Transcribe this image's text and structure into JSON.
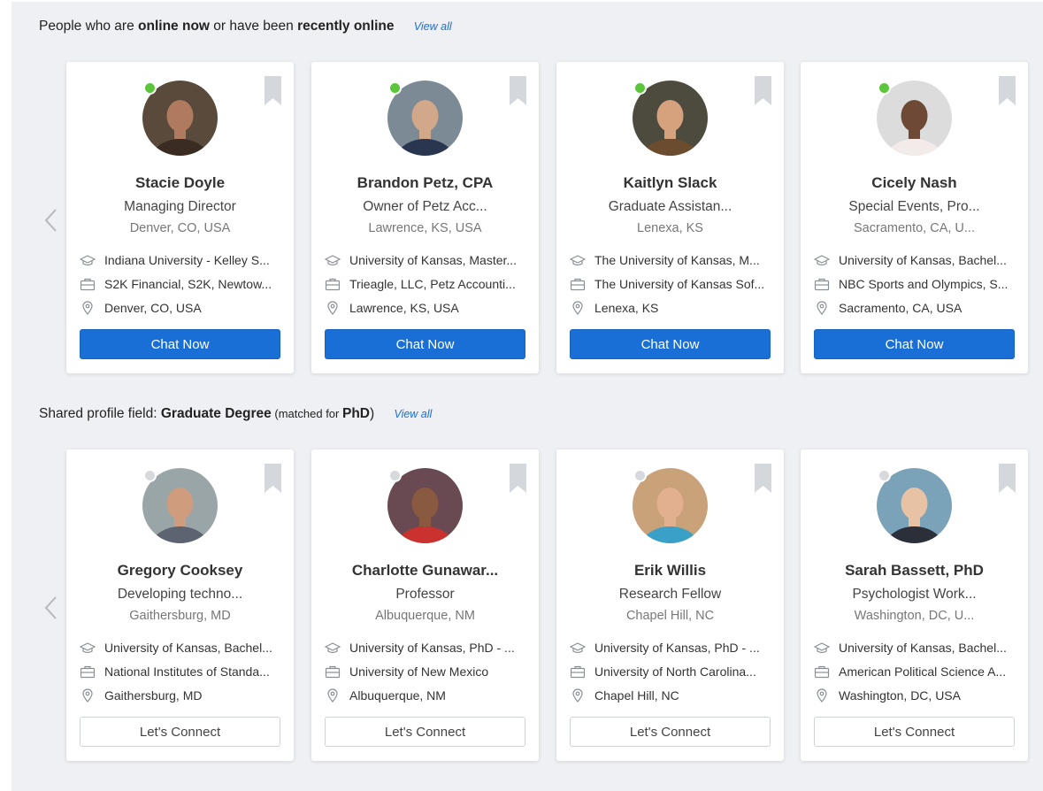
{
  "section1": {
    "prefix": "People who are ",
    "bold1": "online now",
    "middle": " or have been ",
    "bold2": "recently online",
    "view_all": "View all"
  },
  "section2": {
    "prefix": "Shared profile field: ",
    "bold1": "Graduate Degree",
    "middle": " (matched for ",
    "bold2": "PhD",
    "suffix": ")",
    "view_all": "View all"
  },
  "arrow_glyph": "chevron-left-icon",
  "colors": {
    "accent": "#1a6fd6",
    "online": "#5cc63a",
    "offline": "#d7d9dc",
    "bookmark": "#d4d7db"
  },
  "row1": [
    {
      "name": "Stacie Doyle",
      "title": "Managing Director",
      "location": "Denver, CO, USA",
      "education": "Indiana University - Kelley S...",
      "work": "S2K Financial, S2K, Newtow...",
      "place": "Denver, CO, USA",
      "button": "Chat Now",
      "status": "online"
    },
    {
      "name": "Brandon Petz, CPA",
      "title": "Owner of Petz Acc...",
      "location": "Lawrence, KS, USA",
      "education": "University of Kansas, Master...",
      "work": "Trieagle, LLC, Petz Accounti...",
      "place": "Lawrence, KS, USA",
      "button": "Chat Now",
      "status": "online"
    },
    {
      "name": "Kaitlyn Slack",
      "title": "Graduate Assistan...",
      "location": "Lenexa, KS",
      "education": "The University of Kansas, M...",
      "work": "The University of Kansas Sof...",
      "place": "Lenexa, KS",
      "button": "Chat Now",
      "status": "online"
    },
    {
      "name": "Cicely Nash",
      "title": "Special Events, Pro...",
      "location": "Sacramento, CA, U...",
      "education": "University of Kansas, Bachel...",
      "work": "NBC Sports and Olympics, S...",
      "place": "Sacramento, CA, USA",
      "button": "Chat Now",
      "status": "online"
    }
  ],
  "row2": [
    {
      "name": "Gregory Cooksey",
      "title": "Developing techno...",
      "location": "Gaithersburg, MD",
      "education": "University of Kansas, Bachel...",
      "work": "National Institutes of Standa...",
      "place": "Gaithersburg, MD",
      "button": "Let's Connect",
      "status": "offline"
    },
    {
      "name": "Charlotte Gunawar...",
      "title": "Professor",
      "location": "Albuquerque, NM",
      "education": "University of Kansas, PhD - ...",
      "work": "University of New Mexico",
      "place": "Albuquerque, NM",
      "button": "Let's Connect",
      "status": "offline"
    },
    {
      "name": "Erik Willis",
      "title": "Research Fellow",
      "location": "Chapel Hill, NC",
      "education": "University of Kansas, PhD - ...",
      "work": "University of North Carolina...",
      "place": "Chapel Hill, NC",
      "button": "Let's Connect",
      "status": "offline"
    },
    {
      "name": "Sarah Bassett, PhD",
      "title": "Psychologist Work...",
      "location": "Washington, DC, U...",
      "education": "University of Kansas, Bachel...",
      "work": "American Political Science A...",
      "place": "Washington, DC, USA",
      "button": "Let's Connect",
      "status": "offline"
    }
  ]
}
